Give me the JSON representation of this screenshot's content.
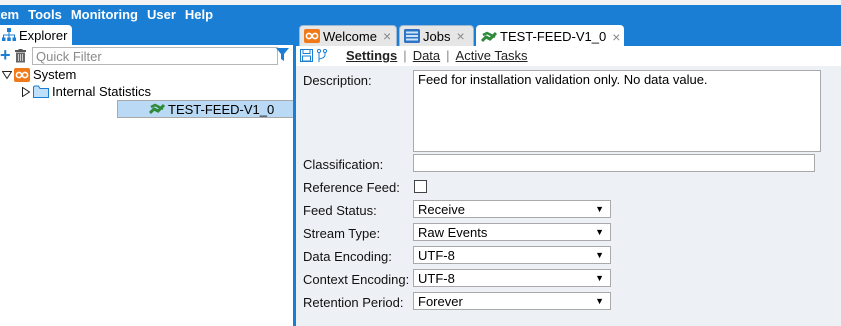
{
  "menu": [
    "tem",
    "Tools",
    "Monitoring",
    "User",
    "Help"
  ],
  "explorer": {
    "tab_label": "Explorer",
    "filter_placeholder": "Quick Filter",
    "tree": [
      {
        "label": "System",
        "expanded": true,
        "level": 0,
        "icon": "system-icon"
      },
      {
        "label": "Internal Statistics",
        "expanded": false,
        "level": 1,
        "icon": "folder-icon"
      },
      {
        "label": "TEST-FEED-V1_0",
        "level": 1,
        "icon": "feed-icon",
        "selected": true
      }
    ]
  },
  "tabs": [
    {
      "label": "Welcome",
      "icon": "welcome-icon"
    },
    {
      "label": "Jobs",
      "icon": "jobs-icon"
    },
    {
      "label": "TEST-FEED-V1_0",
      "icon": "feed-icon",
      "active": true
    }
  ],
  "subtabs": [
    "Settings",
    "Data",
    "Active Tasks"
  ],
  "form": {
    "description_label": "Description:",
    "description_value": "Feed for installation validation only. No data value.",
    "classification_label": "Classification:",
    "classification_value": "",
    "reference_feed_label": "Reference Feed:",
    "reference_feed_checked": false,
    "feed_status_label": "Feed Status:",
    "feed_status_value": "Receive",
    "stream_type_label": "Stream Type:",
    "stream_type_value": "Raw Events",
    "data_encoding_label": "Data Encoding:",
    "data_encoding_value": "UTF-8",
    "context_encoding_label": "Context Encoding:",
    "context_encoding_value": "UTF-8",
    "retention_period_label": "Retention Period:",
    "retention_period_value": "Forever"
  },
  "colors": {
    "accent": "#1a7fd4",
    "selection": "#b9d9f5",
    "panel": "#edf1f6",
    "feed_green": "#2f8a3a",
    "system_orange": "#f07a1a"
  }
}
